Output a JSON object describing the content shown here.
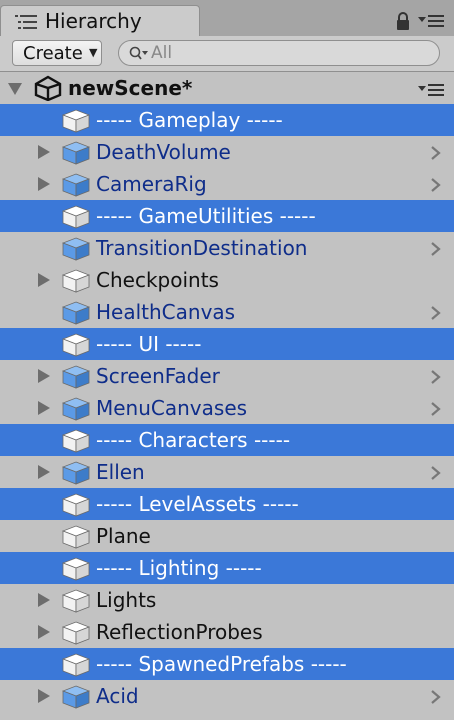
{
  "window": {
    "tab_title": "Hierarchy",
    "tab_icon": "hierarchy-list-icon",
    "lock_icon": "lock-icon",
    "menu_icon": "panel-menu-icon"
  },
  "toolbar": {
    "create_label": "Create",
    "search_placeholder": "All",
    "search_value": ""
  },
  "scene": {
    "name": "newScene*",
    "icon": "unity-logo-icon"
  },
  "colors": {
    "selection": "#3b78d8",
    "prefab_text": "#0f2d8a",
    "normal_text": "#111111",
    "panel_bg": "#c2c2c2"
  },
  "items": [
    {
      "label": "----- Gameplay -----",
      "kind": "separator",
      "selected": true,
      "foldout": "none",
      "prefab": false,
      "chevron": false
    },
    {
      "label": "DeathVolume",
      "kind": "prefab",
      "selected": false,
      "foldout": "closed",
      "prefab": true,
      "chevron": true
    },
    {
      "label": "CameraRig",
      "kind": "prefab",
      "selected": false,
      "foldout": "closed",
      "prefab": true,
      "chevron": true
    },
    {
      "label": "----- GameUtilities -----",
      "kind": "separator",
      "selected": true,
      "foldout": "none",
      "prefab": false,
      "chevron": false
    },
    {
      "label": "TransitionDestination",
      "kind": "prefab",
      "selected": false,
      "foldout": "none",
      "prefab": true,
      "chevron": true
    },
    {
      "label": "Checkpoints",
      "kind": "object",
      "selected": false,
      "foldout": "closed",
      "prefab": false,
      "chevron": false
    },
    {
      "label": "HealthCanvas",
      "kind": "prefab",
      "selected": false,
      "foldout": "none",
      "prefab": true,
      "chevron": true
    },
    {
      "label": "----- UI -----",
      "kind": "separator",
      "selected": true,
      "foldout": "none",
      "prefab": false,
      "chevron": false
    },
    {
      "label": "ScreenFader",
      "kind": "prefab",
      "selected": false,
      "foldout": "closed",
      "prefab": true,
      "chevron": true
    },
    {
      "label": "MenuCanvases",
      "kind": "prefab",
      "selected": false,
      "foldout": "closed",
      "prefab": true,
      "chevron": true
    },
    {
      "label": "----- Characters -----",
      "kind": "separator",
      "selected": true,
      "foldout": "none",
      "prefab": false,
      "chevron": false
    },
    {
      "label": "Ellen",
      "kind": "prefab",
      "selected": false,
      "foldout": "closed",
      "prefab": true,
      "chevron": true
    },
    {
      "label": "----- LevelAssets -----",
      "kind": "separator",
      "selected": true,
      "foldout": "none",
      "prefab": false,
      "chevron": false
    },
    {
      "label": "Plane",
      "kind": "object",
      "selected": false,
      "foldout": "none",
      "prefab": false,
      "chevron": false
    },
    {
      "label": "----- Lighting -----",
      "kind": "separator",
      "selected": true,
      "foldout": "none",
      "prefab": false,
      "chevron": false
    },
    {
      "label": "Lights",
      "kind": "object",
      "selected": false,
      "foldout": "closed",
      "prefab": false,
      "chevron": false
    },
    {
      "label": "ReflectionProbes",
      "kind": "object",
      "selected": false,
      "foldout": "closed",
      "prefab": false,
      "chevron": false
    },
    {
      "label": "----- SpawnedPrefabs -----",
      "kind": "separator",
      "selected": true,
      "foldout": "none",
      "prefab": false,
      "chevron": false
    },
    {
      "label": "Acid",
      "kind": "prefab",
      "selected": false,
      "foldout": "closed",
      "prefab": true,
      "chevron": true
    }
  ]
}
